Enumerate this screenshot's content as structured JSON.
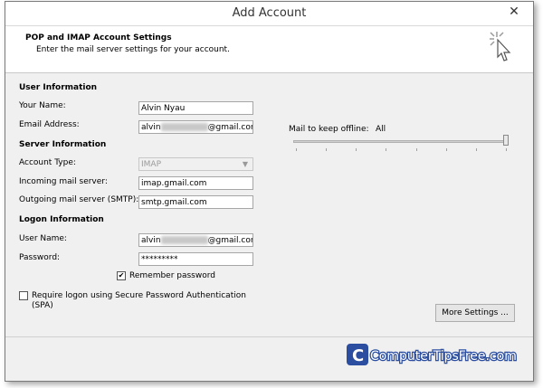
{
  "window": {
    "title": "Add Account",
    "close_glyph": "✕"
  },
  "header": {
    "title": "POP and IMAP Account Settings",
    "subtitle": "Enter the mail server settings for your account.",
    "icon": "wizard-cursor-icon"
  },
  "user_info": {
    "section": "User Information",
    "name_label": "Your Name:",
    "name_value": "Alvin Nyau",
    "email_label": "Email Address:",
    "email_prefix": "alvin",
    "email_suffix": "@gmail.com"
  },
  "server_info": {
    "section": "Server Information",
    "account_type_label": "Account Type:",
    "account_type_value": "IMAP",
    "incoming_label": "Incoming mail server:",
    "incoming_value": "imap.gmail.com",
    "outgoing_label": "Outgoing mail server (SMTP):",
    "outgoing_value": "smtp.gmail.com"
  },
  "logon_info": {
    "section": "Logon Information",
    "username_label": "User Name:",
    "username_prefix": "alvin",
    "username_suffix": "@gmail.com",
    "password_label": "Password:",
    "password_value": "*********",
    "remember_label": "Remember password",
    "remember_checked": "✔",
    "spa_label_line1": "Require logon using Secure Password Authentication",
    "spa_label_line2": "(SPA)"
  },
  "offline": {
    "label": "Mail to keep offline:",
    "value": "All",
    "slider_level": 1.0
  },
  "buttons": {
    "more_settings": "More Settings ..."
  },
  "watermark": {
    "text": "ComputerTipsFree.com"
  }
}
